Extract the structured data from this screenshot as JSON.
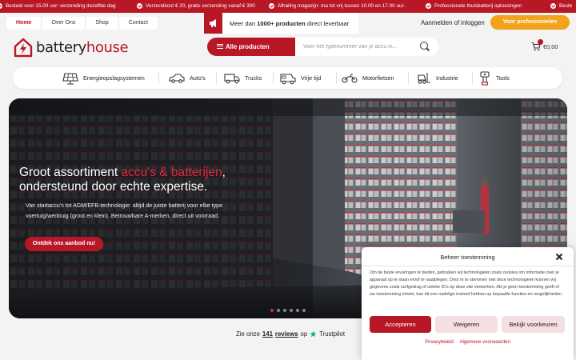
{
  "topbar": {
    "items": [
      "Besteld voor 15.00 uur: verzending dezelfde dag",
      "Verzendkost € 20, gratis verzending vanaf € 300",
      "Afhaling magazijn: ma tot vrij tussen 10.00 en 17.00 uur.",
      "Professionele thuisbatterij oplossingen",
      "Beste"
    ]
  },
  "nav": {
    "links": [
      "Home",
      "Over Ons",
      "Shop",
      "Contact"
    ],
    "promo_prefix": "Meer dan ",
    "promo_bold": "1000+ producten",
    "promo_suffix": " direct leverbaar",
    "login": "Aanmelden of inloggen",
    "pro_button": "Voor professionelen"
  },
  "header": {
    "logo_part1": "battery",
    "logo_part2": "house",
    "all_products": "Alle producten",
    "search_placeholder": "Voer het typenummer van je accu in...",
    "cart_total": "€0,00"
  },
  "categories": [
    {
      "label": "Energieopslagsystemen",
      "icon": "solar-panel-icon"
    },
    {
      "label": "Auto's",
      "icon": "car-icon"
    },
    {
      "label": "Trucks",
      "icon": "truck-icon"
    },
    {
      "label": "Vrije tijd",
      "icon": "camper-icon"
    },
    {
      "label": "Motorfietsen",
      "icon": "motorcycle-icon"
    },
    {
      "label": "Industrie",
      "icon": "forklift-icon"
    },
    {
      "label": "Tools",
      "icon": "drill-icon"
    }
  ],
  "hero": {
    "title_start": "Groot assortiment ",
    "title_highlight": "accu's & batterijen",
    "title_end": ", ondersteund door echte expertise.",
    "text": "Van startaccu's tot AGM/EFB-technologie: altijd de juiste batterij voor elke type voertuig/werktuig (groot en klein). Betrouwbare A-merken, direct uit voorraad.",
    "button": "Ontdek ons aanbod nu!",
    "slides": 6,
    "active_slide": 1
  },
  "trustpilot": {
    "prefix": "Zie onze",
    "count": "141",
    "reviews": "reviews",
    "on": "op",
    "brand": "Trustpilot"
  },
  "cookie": {
    "title": "Beheer toestemming",
    "body": "Om de beste ervaringen te bieden, gebruiken wij technologieën zoals cookies om informatie over je apparaat op te slaan en/of te raadplegen. Door in te stemmen met deze technologieën kunnen wij gegevens zoals surfgedrag of unieke ID's op deze site verwerken. Als je geen toestemming geeft of uw toestemming intrekt, kan dit een nadelige invloed hebben op bepaalde functies en mogelijkheden.",
    "accept": "Accepteren",
    "deny": "Weigeren",
    "prefs": "Bekijk voorkeuren",
    "privacy": "Privacybeleid",
    "terms": "Algemene voorwaarden"
  },
  "colors": {
    "brand_red": "#b81726",
    "accent_orange": "#f2a21b"
  }
}
